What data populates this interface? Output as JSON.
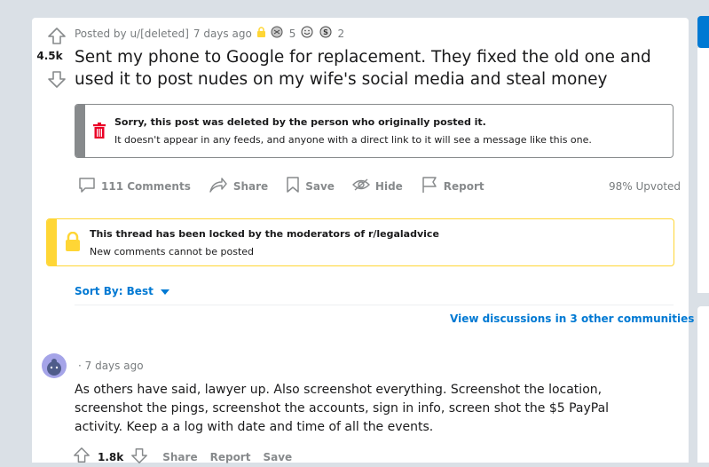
{
  "post": {
    "vote_count": "4.5k",
    "posted_by": "Posted by u/[deleted]",
    "time_ago": "7 days ago",
    "award1_count": "5",
    "award2_count": "2",
    "title": "Sent my phone to Google for replacement. They fixed the old one and used it to post nudes on my wife's social media and steal money"
  },
  "deleted_notice": {
    "title": "Sorry, this post was deleted by the person who originally posted it.",
    "subtitle": "It doesn't appear in any feeds, and anyone with a direct link to it will see a message like this one."
  },
  "actions": {
    "comments": "111 Comments",
    "share": "Share",
    "save": "Save",
    "hide": "Hide",
    "report": "Report",
    "upvoted": "98% Upvoted"
  },
  "locked_notice": {
    "title": "This thread has been locked by the moderators of r/legaladvice",
    "subtitle": "New comments cannot be posted"
  },
  "sort": {
    "label": "Sort By: Best"
  },
  "other_discussions": "View discussions in 3 other communities",
  "comment": {
    "time": "· 7 days ago",
    "body": "As others have said, lawyer up. Also screenshot everything. Screenshot the location, screenshot the pings, screenshot the accounts, sign in info, screen shot the $5 PayPal activity. Keep a a log with date and time of all the events.",
    "vote_count": "1.8k",
    "share": "Share",
    "report": "Report",
    "save": "Save"
  },
  "colors": {
    "accent": "#0079d3",
    "deleted_bar": "#878a8c",
    "trash_icon": "#ea0027",
    "locked_bar": "#ffd635",
    "page_bg": "#dae0e6"
  }
}
